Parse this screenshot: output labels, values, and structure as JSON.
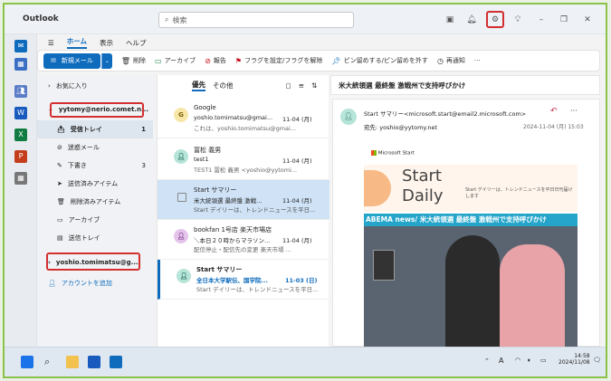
{
  "app": {
    "title": "Outlook",
    "search_placeholder": "検索"
  },
  "tabs": [
    "ホーム",
    "表示",
    "ヘルプ"
  ],
  "ribbon": {
    "new_mail": "新規メール",
    "delete": "削除",
    "archive": "アーカイブ",
    "report": "報告",
    "flag": "フラグを設定/フラグを解除",
    "pin": "ピン留めする/ピン留めを外す",
    "snooze": "再通知",
    "more": "···"
  },
  "folders": {
    "favorites": "お気に入り",
    "account1": "yytomy@nerio.comet.n...",
    "items": [
      {
        "label": "受信トレイ",
        "count": "1"
      },
      {
        "label": "迷惑メール",
        "count": ""
      },
      {
        "label": "下書き",
        "count": "3"
      },
      {
        "label": "送信済みアイテム",
        "count": ""
      },
      {
        "label": "削除済みアイテム",
        "count": ""
      },
      {
        "label": "アーカイブ",
        "count": ""
      },
      {
        "label": "送信トレイ",
        "count": ""
      }
    ],
    "account2": "yoshio.tomimatsu@g...",
    "add_account": "アカウントを追加"
  },
  "list": {
    "tab_focused": "優先",
    "tab_other": "その他",
    "messages": [
      {
        "initial": "G",
        "sender": "Google",
        "subject": "yoshio.tomimatsu@gmai...",
        "preview": "これは、yoshio.tomimatsu@gmai...",
        "date": "11-04 (月)"
      },
      {
        "initial": "",
        "sender": "冨松 義男",
        "subject": "test1",
        "preview": "TEST1 冨松 義男 <yoshio@yytomi...",
        "date": "11-04 (月)"
      },
      {
        "initial": "",
        "sender": "Start サマリー",
        "subject": "米大統領選 最終盤 激戦...",
        "preview": "Start デイリーは、トレンドニュースを平日...",
        "date": "11-04 (月)"
      },
      {
        "initial": "",
        "sender": "bookfan 1号店 楽天市場店",
        "subject": "＼本日２０時からマラソン...",
        "preview": "配信停止・配信先の変更 楽天市場 ...",
        "date": "11-04 (月)"
      },
      {
        "initial": "",
        "sender": "Start サマリー",
        "subject": "全日本大学駅伝、国学院...",
        "preview": "Start デイリーは、トレンドニュースを平日...",
        "date": "11-03 (日)"
      }
    ]
  },
  "reading": {
    "subject": "米大統領選 最終盤 激戦州で支持呼びかけ",
    "from": "Start サマリー<microsoft.start@email2.microsoft.com>",
    "to": "宛先: yoshio@yytomy.net",
    "date": "2024-11-04 (月) 15:03",
    "brand": "Microsoft Start",
    "start_daily": "Start",
    "daily": "Daily",
    "blurb": "Start デイリーは、トレンドニュースを平日日刊届けします",
    "banner": "ABEMA news/ 米大統領選 最終盤 激戦州で支持呼びかけ"
  },
  "taskbar": {
    "time": "14:58",
    "date": "2024/11/08",
    "ime": "A"
  }
}
